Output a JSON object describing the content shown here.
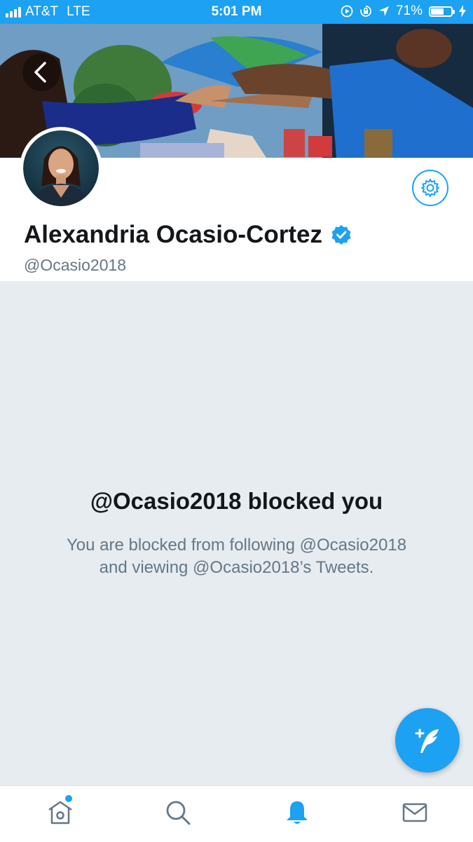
{
  "status_bar": {
    "carrier": "AT&T",
    "network": "LTE",
    "time": "5:01 PM",
    "battery_percent": "71%",
    "battery_level": 0.71
  },
  "header": {
    "banner_image": "crowd-high-five-photo",
    "back_icon": "chevron-left-icon"
  },
  "profile": {
    "name": "Alexandria Ocasio-Cortez",
    "handle": "@Ocasio2018",
    "verified": true,
    "settings_icon": "gear-icon"
  },
  "blocked": {
    "title": "@Ocasio2018 blocked you",
    "message_line1": "You are blocked from following @Ocasio2018",
    "message_line2": "and viewing @Ocasio2018’s Tweets."
  },
  "fab": {
    "icon": "compose-tweet-icon"
  },
  "tabbar": {
    "items": [
      {
        "name": "home",
        "icon": "home-icon",
        "has_badge_dot": true,
        "active": false
      },
      {
        "name": "search",
        "icon": "search-icon",
        "active": false
      },
      {
        "name": "notifications",
        "icon": "bell-icon",
        "active": true
      },
      {
        "name": "messages",
        "icon": "envelope-icon",
        "active": false
      }
    ]
  },
  "colors": {
    "accent": "#1da1f2",
    "text_primary": "#14171a",
    "text_secondary": "#657786",
    "background": "#e6ecf0"
  }
}
